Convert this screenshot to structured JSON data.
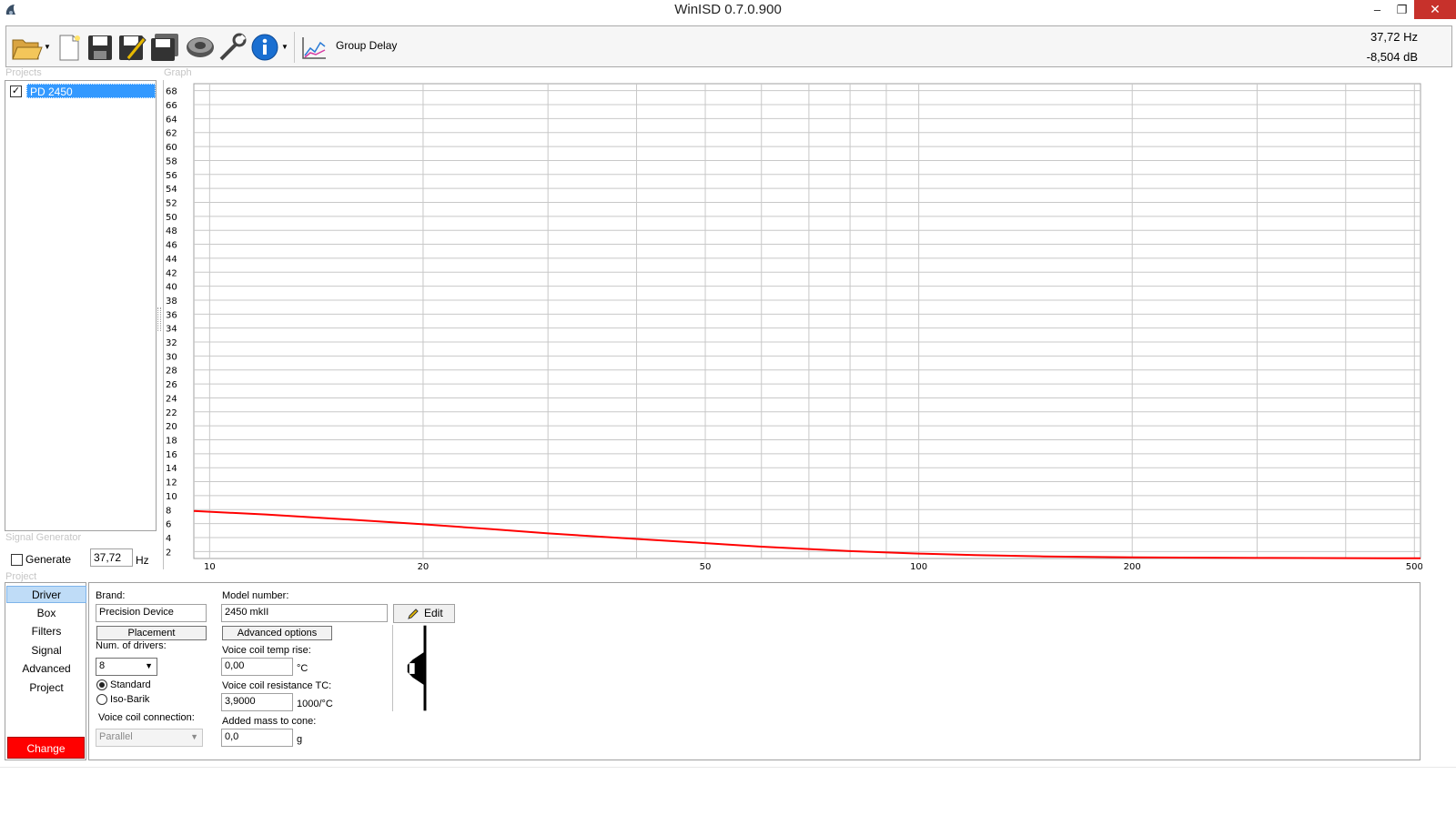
{
  "window": {
    "title": "WinISD 0.7.0.900",
    "minimize_glyph": "‒",
    "maximize_glyph": "❐",
    "close_glyph": "✕"
  },
  "toolbar": {
    "icons": [
      "open-folder-icon",
      "new-project-icon",
      "save-icon",
      "save-as-icon",
      "save-all-icon",
      "driver-icon",
      "tools-icon",
      "info-icon"
    ],
    "graph_type_label": "Group Delay",
    "readout_frequency": "37,72 Hz",
    "readout_level": "-8,504 dB"
  },
  "projects": {
    "caption": "Projects",
    "items": [
      {
        "label": "PD 2450",
        "checked": true
      }
    ]
  },
  "graph": {
    "caption": "Graph"
  },
  "signal_generator": {
    "caption": "Signal Generator",
    "generate_label": "Generate",
    "generate_checked": false,
    "frequency_value": "37,72",
    "frequency_unit": "Hz"
  },
  "project_section": {
    "caption": "Project",
    "nav": [
      "Driver",
      "Box",
      "Filters",
      "Signal",
      "Advanced",
      "Project"
    ],
    "active_nav": "Driver",
    "change_label": "Change"
  },
  "driver": {
    "brand_label": "Brand:",
    "brand_value": "Precision Device",
    "placement_label": "Placement",
    "num_drivers_label": "Num. of drivers:",
    "num_drivers_value": "8",
    "standard_label": "Standard",
    "isobarik_label": "Iso-Barik",
    "selected_mode": "Standard",
    "voice_coil_connection_label": "Voice coil connection:",
    "voice_coil_connection_value": "Parallel",
    "model_label": "Model number:",
    "model_value": "2450 mkII",
    "edit_label": "Edit",
    "advanced_options_label": "Advanced options",
    "temp_rise_label": "Voice coil temp rise:",
    "temp_rise_value": "0,00",
    "temp_rise_unit": "°C",
    "resistance_tc_label": "Voice coil resistance TC:",
    "resistance_tc_value": "3,9000",
    "resistance_tc_unit": "1000/°C",
    "added_mass_label": "Added mass to cone:",
    "added_mass_value": "0,0",
    "added_mass_unit": "g",
    "accent_color": "#3399ff",
    "change_color": "#ff0000"
  },
  "chart_data": {
    "type": "line",
    "xscale": "log",
    "xlim": [
      9.5,
      510
    ],
    "ylim": [
      1,
      69
    ],
    "y_ticks": [
      2,
      4,
      6,
      8,
      10,
      12,
      14,
      16,
      18,
      20,
      22,
      24,
      26,
      28,
      30,
      32,
      34,
      36,
      38,
      40,
      42,
      44,
      46,
      48,
      50,
      52,
      54,
      56,
      58,
      60,
      62,
      64,
      66,
      68
    ],
    "x_tick_labels": [
      10,
      20,
      50,
      100,
      200,
      500
    ],
    "x_gridlines": [
      10,
      20,
      30,
      40,
      50,
      60,
      70,
      80,
      90,
      100,
      200,
      300,
      400,
      500
    ],
    "grid": true,
    "series": [
      {
        "color": "#ff0000",
        "x": [
          9.5,
          12,
          15,
          20,
          25,
          30,
          40,
          50,
          60,
          70,
          80,
          100,
          120,
          150,
          200,
          300,
          400,
          510
        ],
        "y": [
          7.8,
          7.3,
          6.7,
          5.9,
          5.2,
          4.6,
          3.8,
          3.2,
          2.7,
          2.35,
          2.05,
          1.7,
          1.48,
          1.3,
          1.17,
          1.08,
          1.05,
          1.03
        ]
      }
    ]
  }
}
